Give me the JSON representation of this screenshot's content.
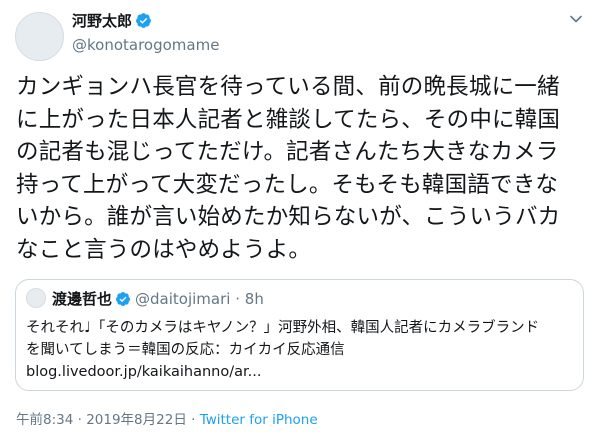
{
  "author": {
    "name": "河野太郎",
    "handle": "@konotarogomame"
  },
  "tweet": {
    "text": "カンギョンハ長官を待っている間、前の晩長城に一緒\nに上がった日本人記者と雑談してたら、その中に韓国\nの記者も混じってただけ。記者さんたち大きなカメラ\n持って上がって大変だったし。そもそも韓国語できな\nいから。誰が言い始めたか知らないが、こういうバカ\nなこと言うのはやめようよ。"
  },
  "quoted": {
    "name": "渡邊哲也",
    "handle": "@daitojimari",
    "separator": "·",
    "time": "8h",
    "text": "それそれ♩「そのカメラはキヤノン？」河野外相、韓国人記者にカメラブランド\nを聞いてしまう＝韓国の反応：カイカイ反応通信\nblog.livedoor.jp/kaikaihanno/ar..."
  },
  "meta": {
    "timestamp": "午前8:34 · 2019年8月22日",
    "separator": " · ",
    "source": "Twitter for iPhone"
  },
  "colors": {
    "accent": "#1da1f2",
    "secondary_text": "#657786",
    "border": "#ccd6dd"
  },
  "icons": {
    "verified": "verified-badge-icon",
    "menu": "chevron-down-icon"
  }
}
